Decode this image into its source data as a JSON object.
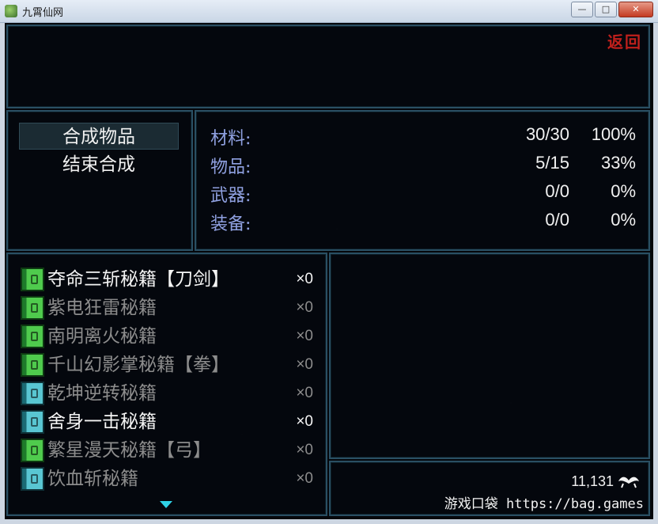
{
  "window": {
    "title": "九霄仙网",
    "minimize": "—",
    "maximize": "□",
    "close": "✕"
  },
  "header": {
    "return_label": "返回"
  },
  "command_menu": [
    {
      "label": "合成物品",
      "selected": true
    },
    {
      "label": "结束合成",
      "selected": false
    }
  ],
  "stats": [
    {
      "label": "材料:",
      "count": "30/30",
      "percent": "100%"
    },
    {
      "label": "物品:",
      "count": "5/15",
      "percent": "33%"
    },
    {
      "label": "武器:",
      "count": "0/0",
      "percent": "0%"
    },
    {
      "label": "装备:",
      "count": "0/0",
      "percent": "0%"
    }
  ],
  "recipe_list": [
    {
      "name": "夺命三斩秘籍【刀剑】",
      "qty": "×0",
      "icon": "green-book-icon",
      "state": "bright"
    },
    {
      "name": "紫电狂雷秘籍",
      "qty": "×0",
      "icon": "green-book-icon",
      "state": "dim"
    },
    {
      "name": "南明离火秘籍",
      "qty": "×0",
      "icon": "green-book-icon",
      "state": "dim"
    },
    {
      "name": "千山幻影掌秘籍【拳】",
      "qty": "×0",
      "icon": "green-book-icon",
      "state": "dim"
    },
    {
      "name": "乾坤逆转秘籍",
      "qty": "×0",
      "icon": "cyan-book-icon",
      "state": "dim"
    },
    {
      "name": "舍身一击秘籍",
      "qty": "×0",
      "icon": "cyan-book-icon",
      "state": "bright"
    },
    {
      "name": "繁星漫天秘籍【弓】",
      "qty": "×0",
      "icon": "green-book-icon",
      "state": "dim"
    },
    {
      "name": "饮血斩秘籍",
      "qty": "×0",
      "icon": "cyan-book-icon",
      "state": "dim"
    }
  ],
  "gold": {
    "amount": "11,131",
    "icon": "mustache-currency-icon"
  },
  "watermark": "游戏口袋 https://bag.games",
  "colors": {
    "accent_return": "#c0201c",
    "stat_label": "#8fa0e0",
    "panel_border": "#2a4f63",
    "scroll_arrow": "#2fd1e6"
  }
}
